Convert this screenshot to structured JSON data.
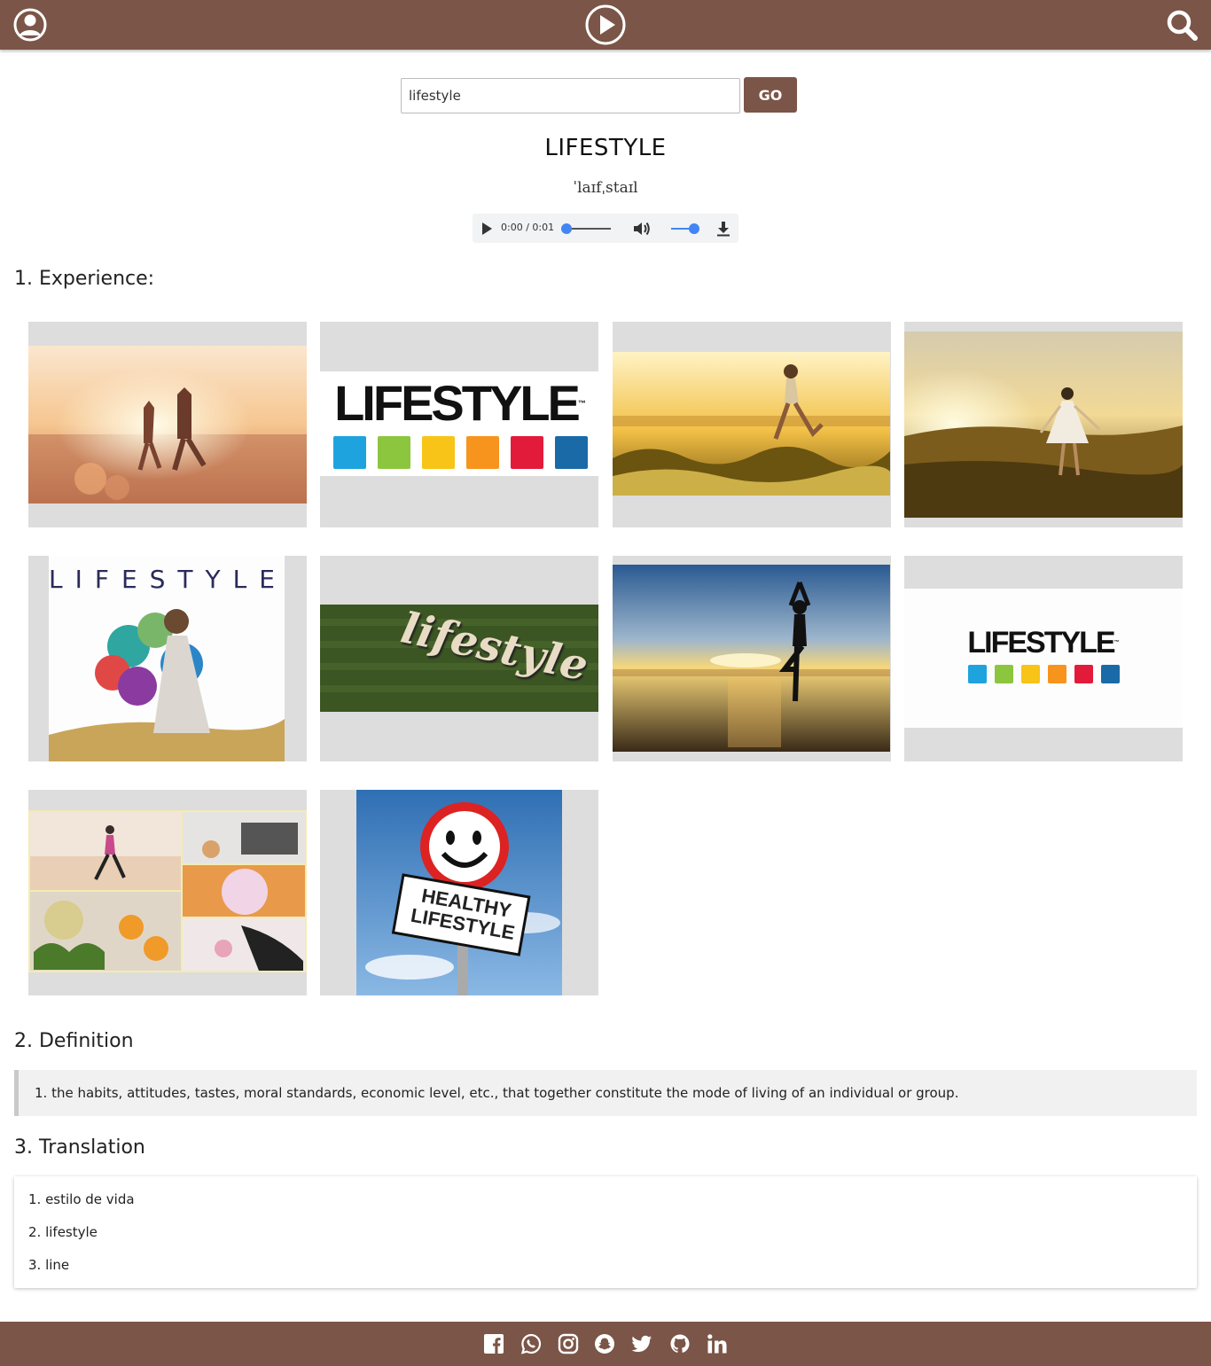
{
  "header": {
    "user_icon": "user-circle-icon",
    "logo_icon": "play-circle-icon",
    "search_icon": "search-icon"
  },
  "search": {
    "value": "lifestyle",
    "go_label": "GO"
  },
  "word": {
    "title": "LIFESTYLE",
    "phonetic": "ˈlaɪfˌstaɪl"
  },
  "audio": {
    "time": "0:00 / 0:01"
  },
  "sections": {
    "experience": "1. Experience:",
    "definition": "2. Definition",
    "translation": "3. Translation"
  },
  "images": {
    "logo_text": "LIFESTYLE",
    "tm": "™",
    "magazine_title": "LIFESTYLE",
    "grass_text": "lifestyle",
    "sign_line1": "HEALTHY",
    "sign_line2": "LIFESTYLE",
    "logo_colors": [
      "#1fa3df",
      "#8cc63f",
      "#f7c417",
      "#f7941d",
      "#e31b3b",
      "#1b6aa8"
    ]
  },
  "definitions": [
    "1. the habits, attitudes, tastes, moral standards, economic level, etc., that together constitute the mode of living of an individual or group."
  ],
  "translations": [
    "1. estilo de vida",
    "2. lifestyle",
    "3. line"
  ],
  "footer": {
    "icons": [
      "facebook-icon",
      "whatsapp-icon",
      "instagram-icon",
      "snapchat-icon",
      "twitter-icon",
      "github-icon",
      "linkedin-icon"
    ]
  },
  "colors": {
    "brand": "#7b5547",
    "audio_accent": "#4285f4"
  }
}
